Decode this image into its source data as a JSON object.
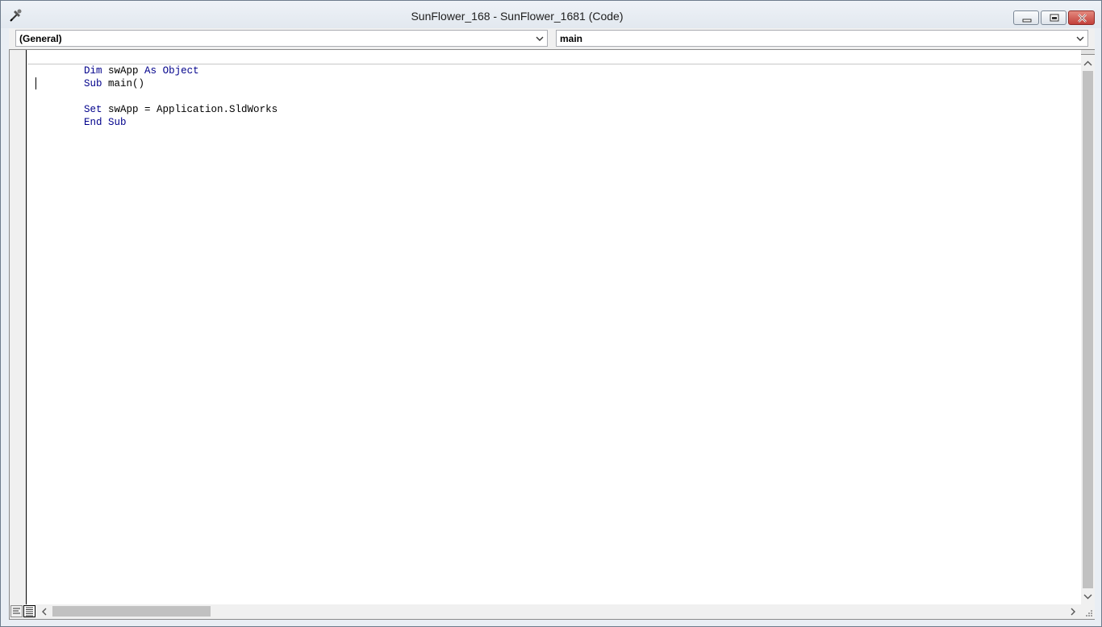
{
  "window": {
    "title": "SunFlower_168 - SunFlower_1681 (Code)"
  },
  "dropdowns": {
    "object": "(General)",
    "procedure": "main"
  },
  "code": {
    "lines": [
      "Dim swApp As Object",
      "Sub main()",
      "",
      "Set swApp = Application.SldWorks",
      "End Sub"
    ]
  },
  "icons": {
    "app": "vba-tools-icon",
    "minimize": "minimize-icon",
    "maximize": "restore-icon",
    "close": "close-icon",
    "combo_arrow": "chevron-down-icon",
    "procedure_view": "procedure-view-icon",
    "full_module_view": "full-module-view-icon"
  },
  "colors": {
    "keyword": "#00008b",
    "close_button": "#c3403a"
  }
}
